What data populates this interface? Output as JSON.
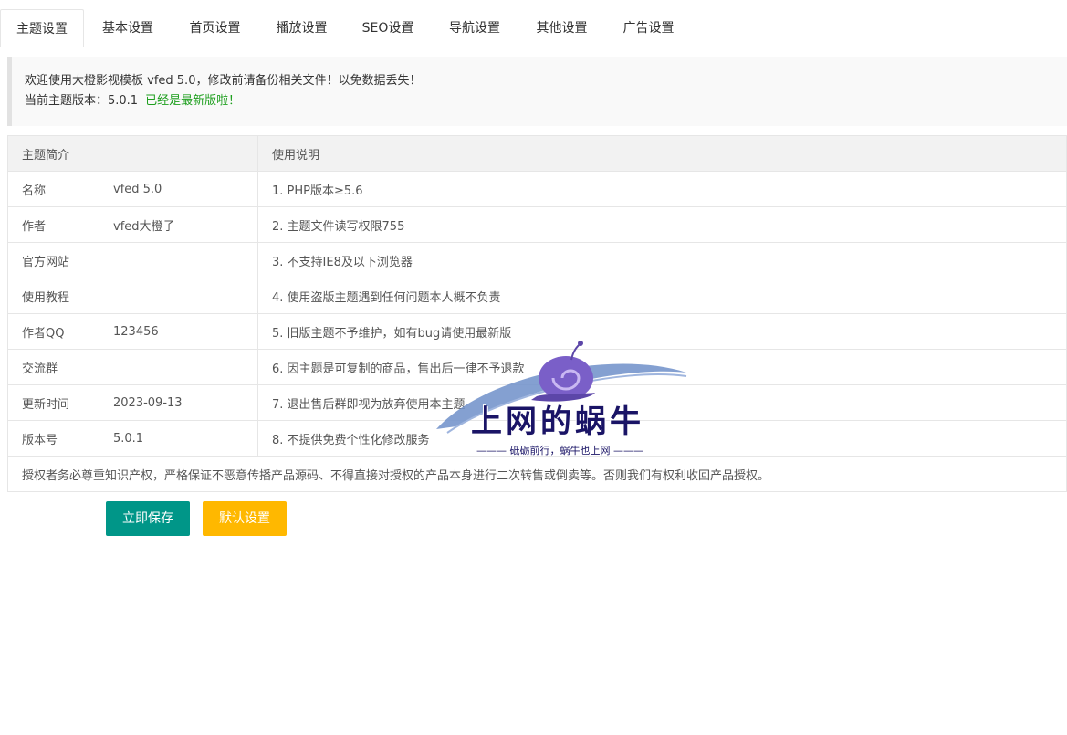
{
  "tabs": [
    {
      "label": "主题设置",
      "active": true
    },
    {
      "label": "基本设置",
      "active": false
    },
    {
      "label": "首页设置",
      "active": false
    },
    {
      "label": "播放设置",
      "active": false
    },
    {
      "label": "SEO设置",
      "active": false
    },
    {
      "label": "导航设置",
      "active": false
    },
    {
      "label": "其他设置",
      "active": false
    },
    {
      "label": "广告设置",
      "active": false
    }
  ],
  "notice": {
    "welcome": "欢迎使用大橙影视模板 vfed 5.0，修改前请备份相关文件！以免数据丢失！",
    "version_label": "当前主题版本：5.0.1",
    "version_status": "已经是最新版啦！"
  },
  "table": {
    "header_left": "主题简介",
    "header_right": "使用说明",
    "rows": [
      {
        "label": "名称",
        "value": "vfed 5.0",
        "note": "1. PHP版本≥5.6"
      },
      {
        "label": "作者",
        "value": "vfed大橙子",
        "note": "2. 主题文件读写权限755"
      },
      {
        "label": "官方网站",
        "value": "",
        "note": "3. 不支持IE8及以下浏览器"
      },
      {
        "label": "使用教程",
        "value": "",
        "note": "4. 使用盗版主题遇到任何问题本人概不负责"
      },
      {
        "label": "作者QQ",
        "value": "123456",
        "note": "5. 旧版主题不予维护，如有bug请使用最新版"
      },
      {
        "label": "交流群",
        "value": "",
        "note": "6. 因主题是可复制的商品，售出后一律不予退款"
      },
      {
        "label": "更新时间",
        "value": "2023-09-13",
        "note": "7. 退出售后群即视为放弃使用本主题"
      },
      {
        "label": "版本号",
        "value": "5.0.1",
        "note": "8. 不提供免费个性化修改服务"
      }
    ],
    "footer": "授权者务必尊重知识产权，严格保证不恶意传播产品源码、不得直接对授权的产品本身进行二次转售或倒卖等。否则我们有权利收回产品授权。"
  },
  "buttons": {
    "save": "立即保存",
    "default": "默认设置"
  },
  "watermark": {
    "title": "上网的蜗牛",
    "subtitle": "——— 砥砺前行，蜗牛也上网 ———"
  },
  "colors": {
    "save_button": "#009688",
    "default_button": "#ffb800",
    "status_ok": "#1e9f1e"
  }
}
